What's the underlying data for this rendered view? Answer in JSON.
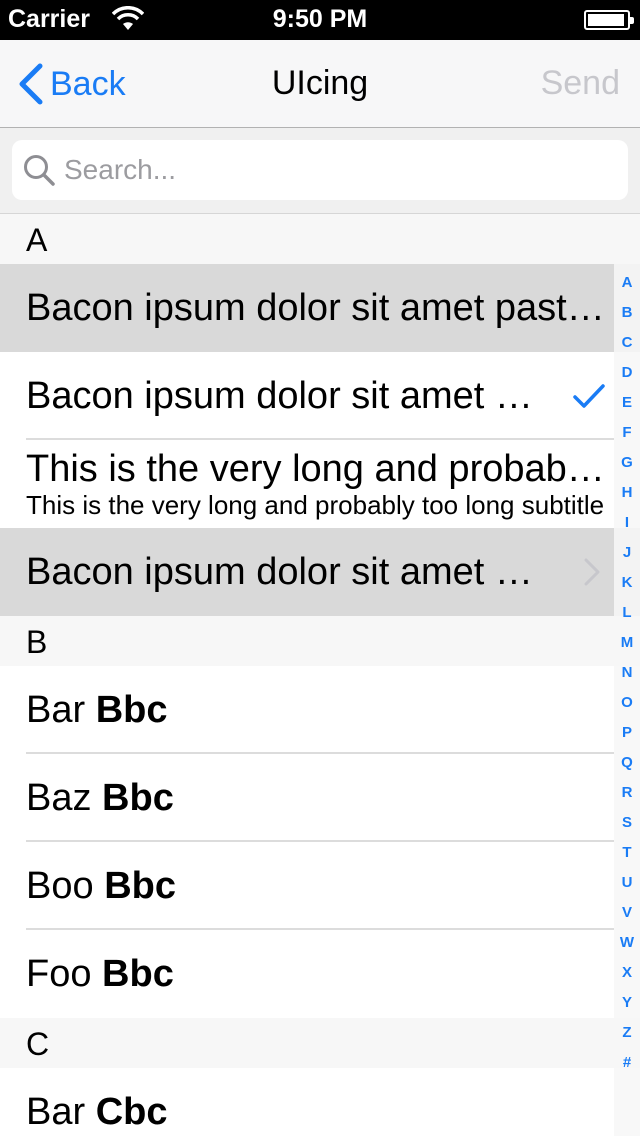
{
  "status_bar": {
    "carrier": "Carrier",
    "time": "9:50 PM"
  },
  "nav": {
    "back_label": "Back",
    "title": "UIcing",
    "send_label": "Send"
  },
  "search": {
    "placeholder": "Search..."
  },
  "sections": [
    {
      "header": "A",
      "rows": [
        {
          "title": "Bacon ipsum dolor sit amet pastrami",
          "selected": true
        },
        {
          "title": "Bacon ipsum dolor sit amet pastrami",
          "accessory": "checkmark-icon"
        },
        {
          "title": "This is the very long and probably too long title",
          "subtitle": "This is the very long and probably too long subtitle"
        },
        {
          "title": "Bacon ipsum dolor sit amet pastrami",
          "selected": true,
          "accessory": "chevron-right-icon"
        }
      ]
    },
    {
      "header": "B",
      "rows": [
        {
          "title_regular": "Bar",
          "title_bold": "Bbc"
        },
        {
          "title_regular": "Baz",
          "title_bold": "Bbc"
        },
        {
          "title_regular": "Boo",
          "title_bold": "Bbc"
        },
        {
          "title_regular": "Foo",
          "title_bold": "Bbc"
        }
      ]
    },
    {
      "header": "C",
      "rows": [
        {
          "title_regular": "Bar",
          "title_bold": "Cbc"
        }
      ]
    }
  ],
  "index": [
    "A",
    "B",
    "C",
    "D",
    "E",
    "F",
    "G",
    "H",
    "I",
    "J",
    "K",
    "L",
    "M",
    "N",
    "O",
    "P",
    "Q",
    "R",
    "S",
    "T",
    "U",
    "V",
    "W",
    "X",
    "Y",
    "Z",
    "#"
  ],
  "colors": {
    "accent": "#1a7cf5",
    "selected_row": "#d9d9d9",
    "section_header": "#f7f7f7",
    "disabled": "#c7c7cc"
  }
}
